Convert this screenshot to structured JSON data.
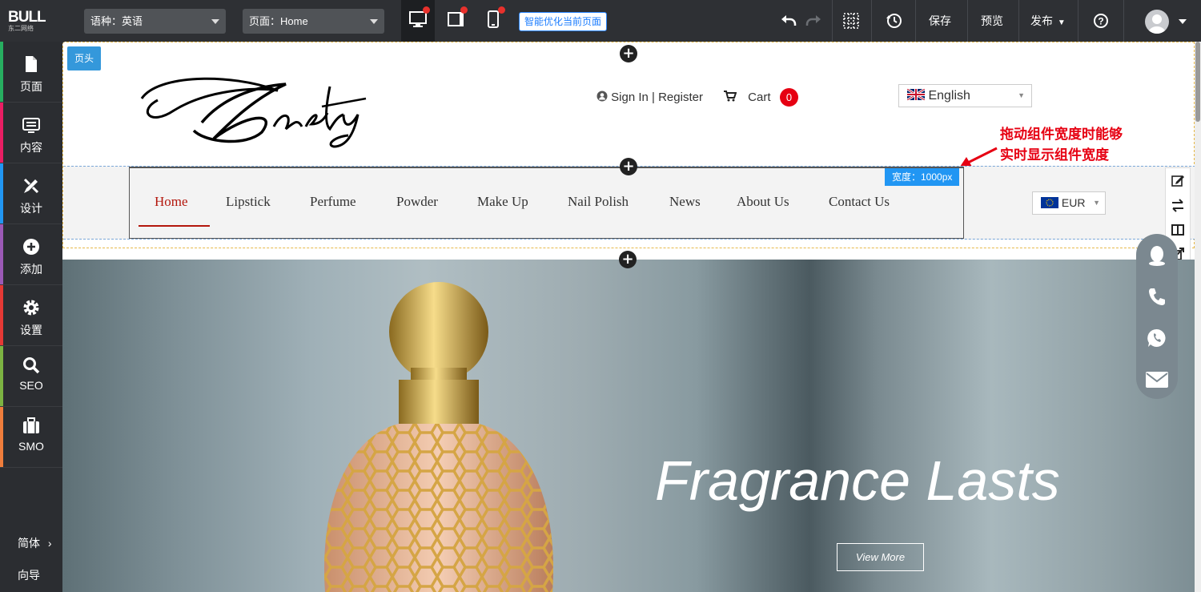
{
  "topbar": {
    "logo_main": "BULL",
    "logo_sub": "东二网络",
    "language_select": "语种：英语",
    "page_select": "页面：Home",
    "optimize_button": "智能优化当前页面",
    "save": "保存",
    "preview": "预览",
    "publish": "发布"
  },
  "sidebar": {
    "items": [
      {
        "label": "页面",
        "icon": "page-icon",
        "color": "#27ae60"
      },
      {
        "label": "内容",
        "icon": "content-icon",
        "color": "#e91e63"
      },
      {
        "label": "设计",
        "icon": "design-icon",
        "color": "#2196f3"
      },
      {
        "label": "添加",
        "icon": "add-icon",
        "color": "#9b59b6"
      },
      {
        "label": "设置",
        "icon": "settings-icon",
        "color": "#e53935"
      },
      {
        "label": "SEO",
        "icon": "search-icon",
        "color": "#7cb342"
      },
      {
        "label": "SMO",
        "icon": "briefcase-icon",
        "color": "#ef7d3c"
      }
    ],
    "lang_switch": "简体",
    "guide": "向导"
  },
  "editor": {
    "section_tag": "页头",
    "width_badge": "宽度：1000px",
    "annotation_line1": "拖动组件宽度时能够",
    "annotation_line2": "实时显示组件宽度"
  },
  "site": {
    "signin": "Sign In | Register",
    "cart_label": "Cart",
    "cart_count": "0",
    "language": "English",
    "currency": "EUR",
    "nav": [
      "Home",
      "Lipstick",
      "Perfume",
      "Powder",
      "Make Up",
      "Nail Polish",
      "News",
      "About Us",
      "Contact Us"
    ],
    "hero_title": "Fragrance Lasts",
    "hero_button": "View More"
  },
  "colors": {
    "accent_blue": "#2196f3",
    "nav_active": "#b3160c",
    "cart_badge": "#e60012",
    "annotation": "#e60012"
  }
}
